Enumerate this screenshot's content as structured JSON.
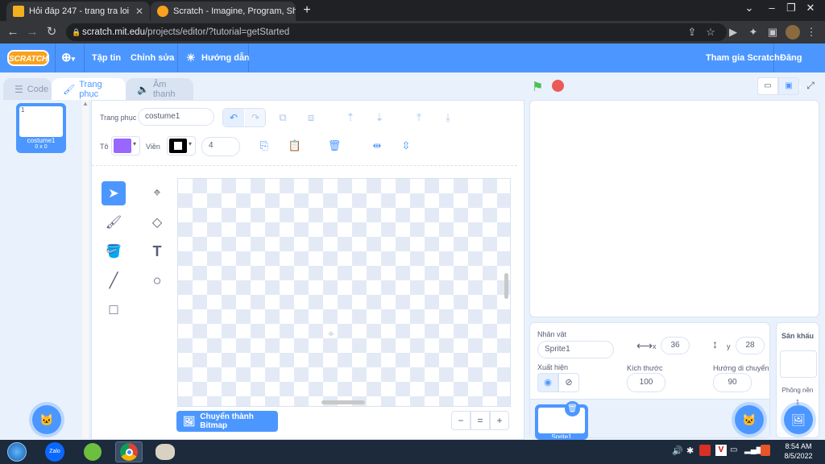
{
  "browser": {
    "tabs": [
      {
        "title": "Hỏi đáp 247 - trang tra loi",
        "close": "✕"
      },
      {
        "title": "Scratch - Imagine, Program, Shar",
        "close": "✕"
      }
    ],
    "new_tab": "+",
    "url_host": "scratch.mit.edu",
    "url_path": "/projects/editor/?tutorial=getStarted"
  },
  "menu": {
    "logo": "SCRATCH",
    "file": "Tập tin",
    "edit": "Chỉnh sửa",
    "tutorials": "Hướng dẫn",
    "join": "Tham gia Scratch",
    "signin": "Đăng nhập"
  },
  "editor_tabs": {
    "code": "Code",
    "costumes": "Trang phục",
    "sounds": "Âm thanh"
  },
  "costume_list": [
    {
      "number": "1",
      "name": "costume1",
      "size": "0 x 0"
    }
  ],
  "paint": {
    "costume_label": "Trang phục",
    "costume_name": "costume1",
    "fill_label": "Tô",
    "outline_label": "Viền",
    "outline_width": "4",
    "fill_color": "#9966ff",
    "outline_color": "#000000",
    "convert_button": "Chuyển thành Bitmap",
    "zoom_out": "−",
    "zoom_reset": "=",
    "zoom_in": "+"
  },
  "sprite_info": {
    "label": "Nhân vật",
    "name": "Sprite1",
    "x_label": "x",
    "x": "36",
    "y_label": "y",
    "y": "28",
    "show_label": "Xuất hiện",
    "size_label": "Kích thước",
    "size": "100",
    "direction_label": "Hướng di chuyển",
    "direction": "90"
  },
  "sprites": [
    {
      "name": "Sprite1"
    }
  ],
  "stage_pane": {
    "label": "Sân khấu",
    "backdrops_label": "Phông nền",
    "backdrop_count": "1"
  },
  "taskbar": {
    "zalo": "Zalo",
    "time": "8:54 AM",
    "date": "8/5/2022"
  },
  "colors": {
    "accent": "#4c97ff",
    "brand": "#f9a21d",
    "text": "#575e75"
  }
}
